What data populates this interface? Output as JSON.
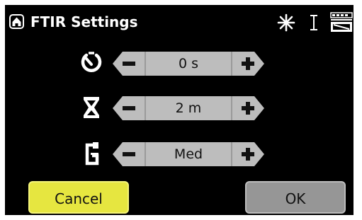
{
  "header": {
    "title": "FTIR Settings",
    "home_icon": "home-icon",
    "status_icons": [
      "laser-icon",
      "cursor-icon",
      "battery-icon"
    ]
  },
  "settings": [
    {
      "icon": "timer-icon",
      "value": "0 s"
    },
    {
      "icon": "hourglass-icon",
      "value": "2 m"
    },
    {
      "icon": "clamp-pressure-icon",
      "value": "Med"
    }
  ],
  "buttons": {
    "cancel_label": "Cancel",
    "ok_label": "OK"
  },
  "colors": {
    "screen_bg": "#000000",
    "stepper_fill": "#bdbdbd",
    "cancel_bg": "#e6e640",
    "ok_bg": "#969696"
  }
}
